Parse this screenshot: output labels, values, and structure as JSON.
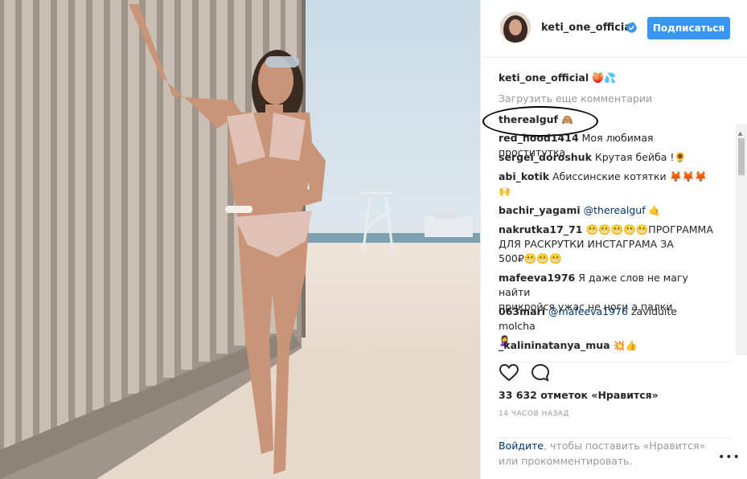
{
  "post": {
    "username": "keti_one_official",
    "follow_label": "Подписаться",
    "caption_user": "keti_one_official",
    "caption_emoji": "🍑💦",
    "load_more": "Загрузить еще комментарии",
    "likes": "33 632 отметок «Нравится»",
    "time": "14 ЧАСОВ НАЗАД",
    "login_link": "Войдите",
    "login_text": ", чтобы поставить «Нравится»",
    "login_text2": "или прокомментировать.",
    "more_icon": "•••"
  },
  "comments": [
    {
      "user": "therealguf",
      "text": "🙈"
    },
    {
      "user": "red_hood1414",
      "text": "Моя любимая проститутка"
    },
    {
      "user": "sergei_doroshuk",
      "text": "Крутая бейба !🌻"
    },
    {
      "user": "abi_kotik",
      "text": "Абиссинские котятки 🦊🦊🦊",
      "line2": "🙌"
    },
    {
      "user": "bachir_yagami",
      "mention": "@therealguf",
      "text": "🤙"
    },
    {
      "user": "nakrutka17_71",
      "text": "😬😬😬😬😬ПРОГРАММА",
      "line2": "ДЛЯ РАСКРУТКИ ИНСТАГРАМА ЗА",
      "line3": "500₽😬😬😬"
    },
    {
      "user": "mafeeva1976",
      "text": "Я даже слов не магу найти",
      "line2": "прикройся ужас не ноги а палки"
    },
    {
      "user": "063mari",
      "mention": "@mafeeva1976",
      "text": "zaviduite molcha",
      "line2": "🙎‍♀️"
    },
    {
      "user": "_kalininatanya_mua",
      "text": "💥👍"
    }
  ],
  "colors": {
    "accent": "#3897f0",
    "link": "#003569",
    "muted": "#999999"
  },
  "icons": [
    "heart-icon",
    "comment-icon",
    "verified-icon",
    "more-icon",
    "scroll-up-icon",
    "scroll-down-icon"
  ]
}
